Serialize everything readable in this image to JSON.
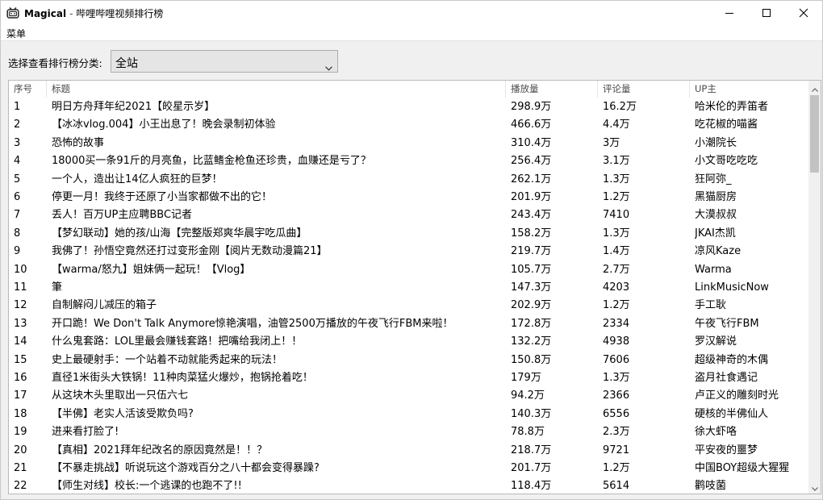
{
  "window": {
    "app_name": "Magical",
    "separator": "-",
    "title": "哔哩哔哩视频排行榜",
    "icon": "bilibili-tv-icon"
  },
  "window_controls": {
    "minimize_icon": "minimize-icon",
    "maximize_icon": "maximize-icon",
    "close_icon": "close-icon"
  },
  "menu": {
    "items": [
      "菜单"
    ]
  },
  "filter": {
    "label": "选择查看排行榜分类:",
    "selected": "全站"
  },
  "table": {
    "columns": [
      "序号",
      "标题",
      "播放量",
      "评论量",
      "UP主"
    ],
    "rows": [
      [
        "1",
        "明日方舟拜年纪2021【皎星示岁】",
        "298.9万",
        "16.2万",
        "哈米伦的弄笛者"
      ],
      [
        "2",
        "【冰冰vlog.004】小王出息了！晚会录制初体验",
        "466.6万",
        "4.4万",
        "吃花椒的喵酱"
      ],
      [
        "3",
        "恐怖的故事",
        "310.4万",
        "3万",
        "小潮院长"
      ],
      [
        "4",
        "18000买一条91斤的月亮鱼，比蓝鳍金枪鱼还珍贵，血赚还是亏了？",
        "256.4万",
        "3.1万",
        "小文哥吃吃吃"
      ],
      [
        "5",
        "一个人，造出让14亿人疯狂的巨梦！",
        "262.1万",
        "1.3万",
        "狂阿弥_"
      ],
      [
        "6",
        "停更一月！我终于还原了小当家都做不出的它！",
        "201.9万",
        "1.2万",
        "黑猫厨房"
      ],
      [
        "7",
        "丢人！百万UP主应聘BBC记者",
        "243.4万",
        "7410",
        "大漠叔叔"
      ],
      [
        "8",
        "【梦幻联动】她的孩/山海【完整版郑爽华晨宇吃瓜曲】",
        "158.2万",
        "1.3万",
        "JKAI杰凯"
      ],
      [
        "9",
        "我佛了！孙悟空竟然还打过变形金刚【阅片无数动漫篇21】",
        "219.7万",
        "1.4万",
        "凉风Kaze"
      ],
      [
        "10",
        "【warma/怒九】姐妹俩一起玩！【Vlog】",
        "105.7万",
        "2.7万",
        "Warma"
      ],
      [
        "11",
        "筆",
        "147.3万",
        "4203",
        "LinkMusicNow"
      ],
      [
        "12",
        "自制解闷儿减压的箱子",
        "202.9万",
        "1.2万",
        "手工耿"
      ],
      [
        "13",
        "开口跪！We Don't Talk Anymore惊艳演唱，油管2500万播放的午夜飞行FBM来啦！",
        "172.8万",
        "2334",
        "午夜飞行FBM"
      ],
      [
        "14",
        "什么鬼套路：LOL里最会赚钱套路！把嘴给我闭上！！",
        "132.2万",
        "4938",
        "罗汉解说"
      ],
      [
        "15",
        "史上最硬射手：一个站着不动就能秀起来的玩法！",
        "150.8万",
        "7606",
        "超级神奇的木偶"
      ],
      [
        "16",
        "直径1米街头大铁锅！11种肉菜猛火爆炒，抱锅抢着吃！",
        "179万",
        "1.3万",
        "盗月社食遇记"
      ],
      [
        "17",
        "从这块木头里取出一只伍六七",
        "94.2万",
        "2366",
        "卢正义的雕刻时光"
      ],
      [
        "18",
        "【半佛】老实人活该受欺负吗?",
        "140.3万",
        "6556",
        "硬核的半佛仙人"
      ],
      [
        "19",
        "进来看打脸了!",
        "78.8万",
        "2.3万",
        "徐大虾咯"
      ],
      [
        "20",
        "【真相】2021拜年纪改名的原因竟然是！！？",
        "218.7万",
        "9721",
        "平安夜的噩梦"
      ],
      [
        "21",
        "【不暴走挑战】听说玩这个游戏百分之八十都会变得暴躁?",
        "201.7万",
        "1.2万",
        "中国BOY超级大猩猩"
      ],
      [
        "22",
        "【师生对线】校长:一个逃课的也跑不了!!",
        "118.4万",
        "5614",
        "鹳吱菌"
      ]
    ]
  },
  "scrollbar": {
    "up_icon": "scroll-up-arrow-icon",
    "down_icon": "scroll-down-arrow-icon"
  }
}
